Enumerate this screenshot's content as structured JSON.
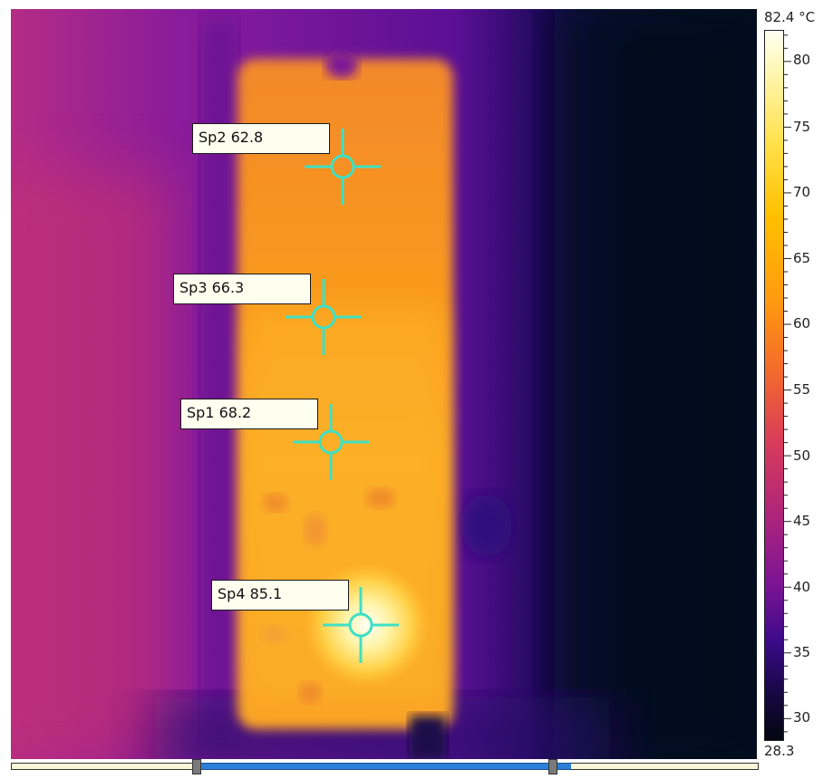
{
  "spots": [
    {
      "id": "sp2",
      "label": "Sp2 62.8"
    },
    {
      "id": "sp3",
      "label": "Sp3 66.3"
    },
    {
      "id": "sp1",
      "label": "Sp1 68.2"
    },
    {
      "id": "sp4",
      "label": "Sp4 85.1"
    }
  ],
  "colorbar": {
    "max_label": "82.4 °C",
    "min_label": "28.3",
    "ticks": [
      "80",
      "75",
      "70",
      "65",
      "60",
      "55",
      "50",
      "45",
      "40",
      "35",
      "30"
    ]
  },
  "range_slider": {
    "low_fraction": 0.25,
    "high_fraction": 0.75
  },
  "colors": {
    "marker": "#3fe0c4",
    "range_fill": "#2b7fd8"
  }
}
